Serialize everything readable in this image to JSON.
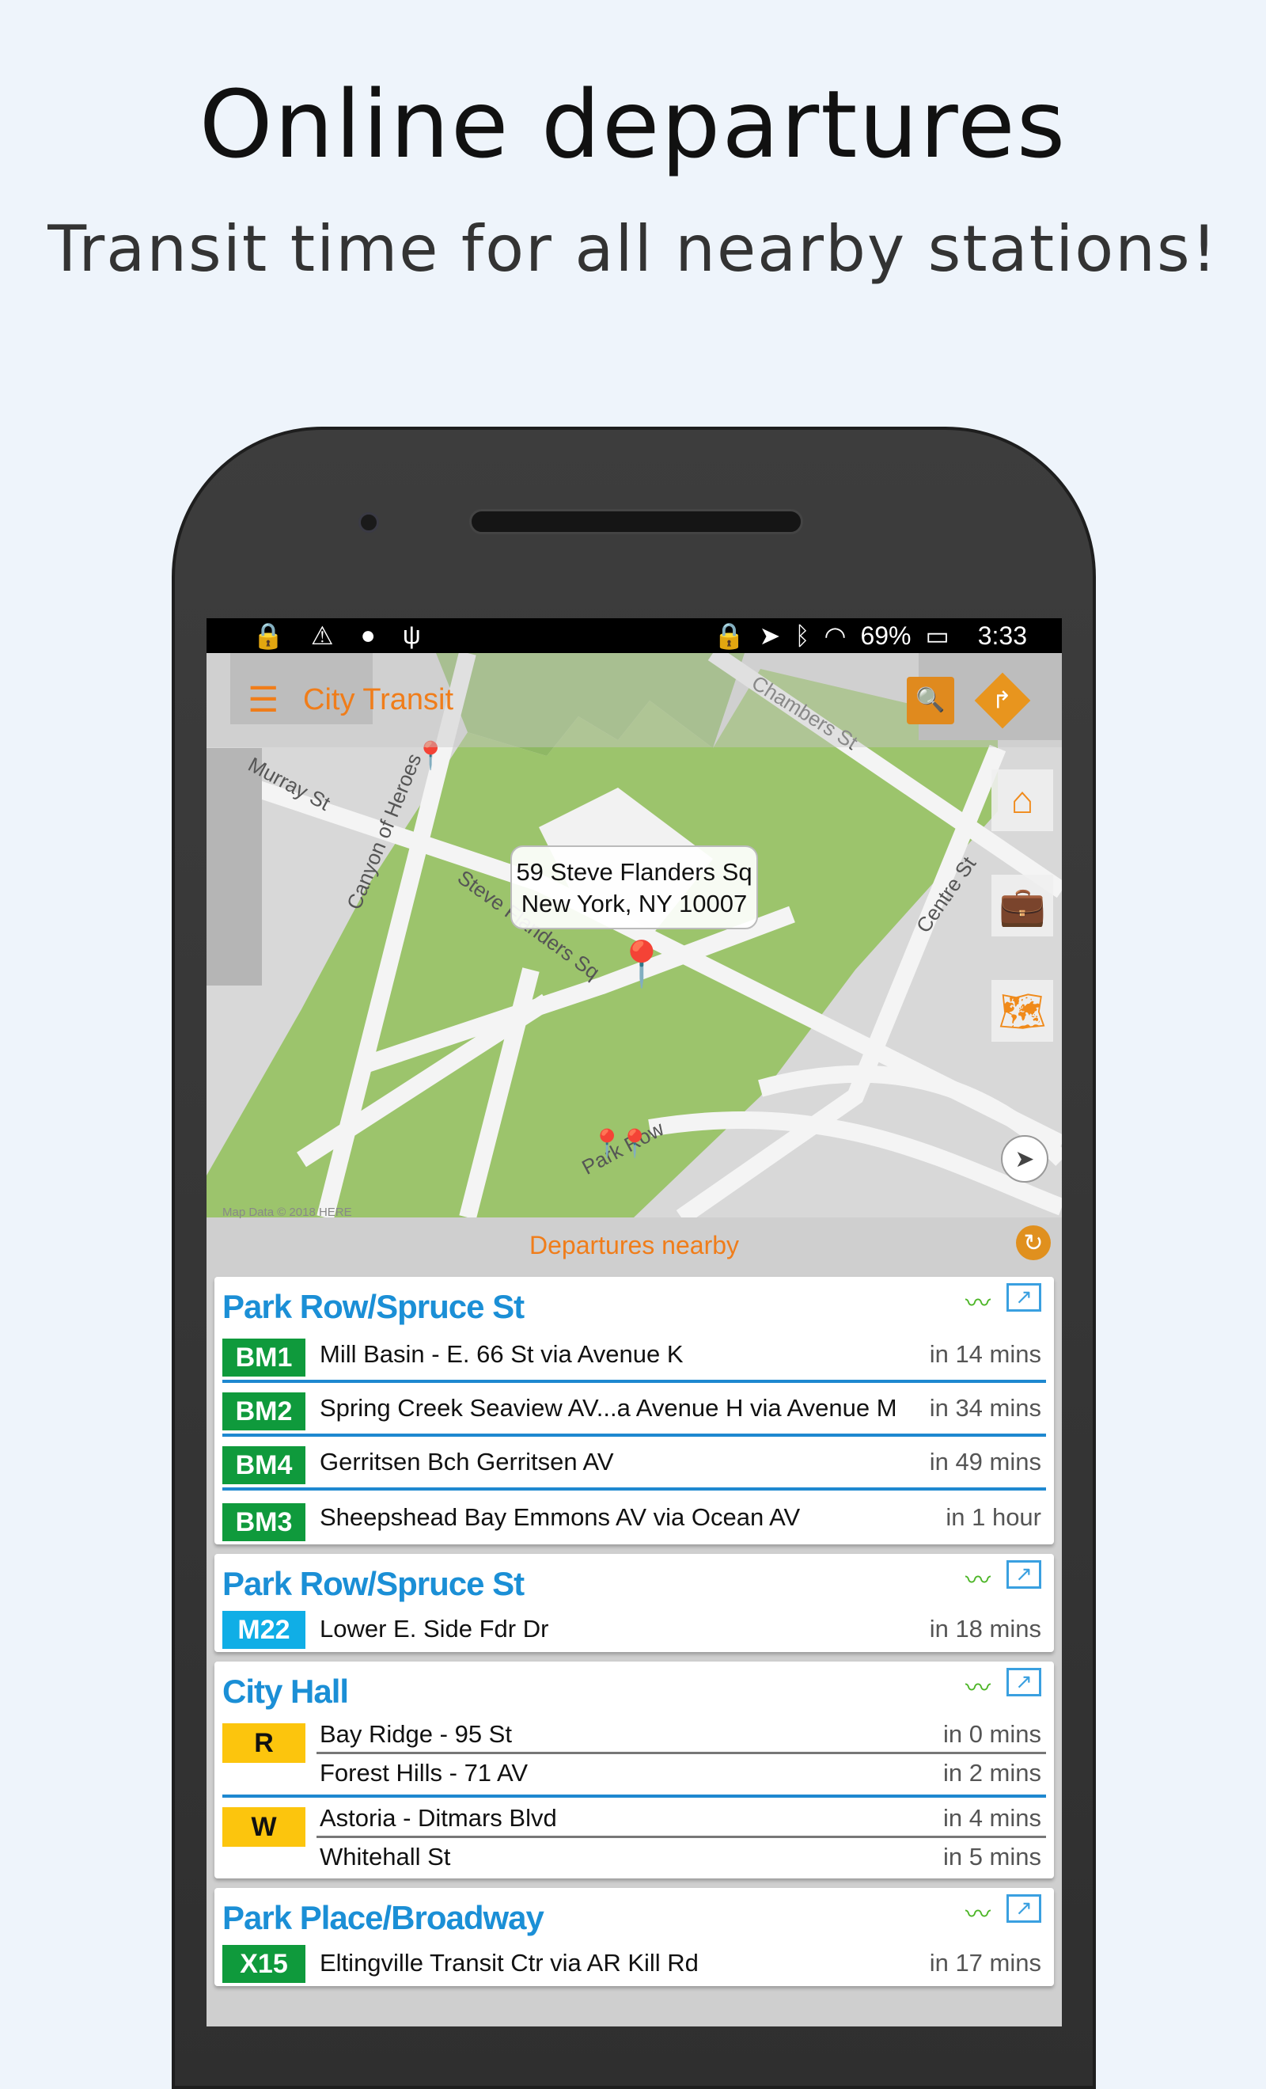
{
  "promo": {
    "title": "Online departures",
    "subtitle": "Transit time for all nearby stations!"
  },
  "status_bar": {
    "left_icons": [
      "lock-icon",
      "warning-icon",
      "android-icon",
      "usb-icon"
    ],
    "right_icons": [
      "lock-icon",
      "location-icon",
      "bluetooth-icon",
      "wifi-icon",
      "battery-charging-icon"
    ],
    "battery": "69%",
    "time": "3:33"
  },
  "app_bar": {
    "title": "City Transit",
    "menu_icon": "hamburger-icon",
    "search_icon": "map-search-icon",
    "directions_icon": "directions-icon"
  },
  "map": {
    "address_line1": "59 Steve Flanders Sq",
    "address_line2": "New York, NY 10007",
    "labels": {
      "murray": "Murray St",
      "canyon": "Canyon of Heroes",
      "steve": "Steve Flanders Sq",
      "chambers": "Chambers St",
      "centre": "Centre St",
      "parkrow": "Park Row"
    },
    "credit": "Map Data © 2018 HERE",
    "fabs": [
      "home-icon",
      "briefcase-icon",
      "map-icon",
      "compass-icon"
    ]
  },
  "departures": {
    "title": "Departures nearby",
    "colors": {
      "green": "#0f9a3c",
      "cyan": "#10aee6",
      "yellow": "#fcc50d",
      "station": "#1b8fd6",
      "accent": "#f07d1a"
    },
    "stations": [
      {
        "name": "Park Row/Spruce St",
        "routes": [
          {
            "route": "BM1",
            "dest": "Mill Basin - E. 66 St via Avenue K",
            "time": "in 14 mins"
          },
          {
            "route": "BM2",
            "dest": "Spring Creek Seaview AV...a Avenue H via Avenue M",
            "time": "in 34 mins"
          },
          {
            "route": "BM4",
            "dest": "Gerritsen Bch Gerritsen AV",
            "time": "in 49 mins"
          },
          {
            "route": "BM3",
            "dest": "Sheepshead Bay Emmons AV via Ocean AV",
            "time": "in 1 hour"
          }
        ]
      },
      {
        "name": "Park Row/Spruce St",
        "routes": [
          {
            "route": "M22",
            "dest": "Lower E. Side Fdr Dr",
            "time": "in 18 mins"
          }
        ]
      },
      {
        "name": "City Hall",
        "groups": [
          {
            "route": "R",
            "trips": [
              {
                "dest": "Bay Ridge - 95 St",
                "time": "in 0 mins"
              },
              {
                "dest": "Forest Hills - 71 AV",
                "time": "in 2 mins"
              }
            ]
          },
          {
            "route": "W",
            "trips": [
              {
                "dest": "Astoria - Ditmars Blvd",
                "time": "in 4 mins"
              },
              {
                "dest": "Whitehall St",
                "time": "in 5 mins"
              }
            ]
          }
        ]
      },
      {
        "name": "Park Place/Broadway",
        "routes": [
          {
            "route": "X15",
            "dest": "Eltingville Transit Ctr via AR Kill Rd",
            "time": "in 17 mins"
          }
        ]
      }
    ]
  }
}
